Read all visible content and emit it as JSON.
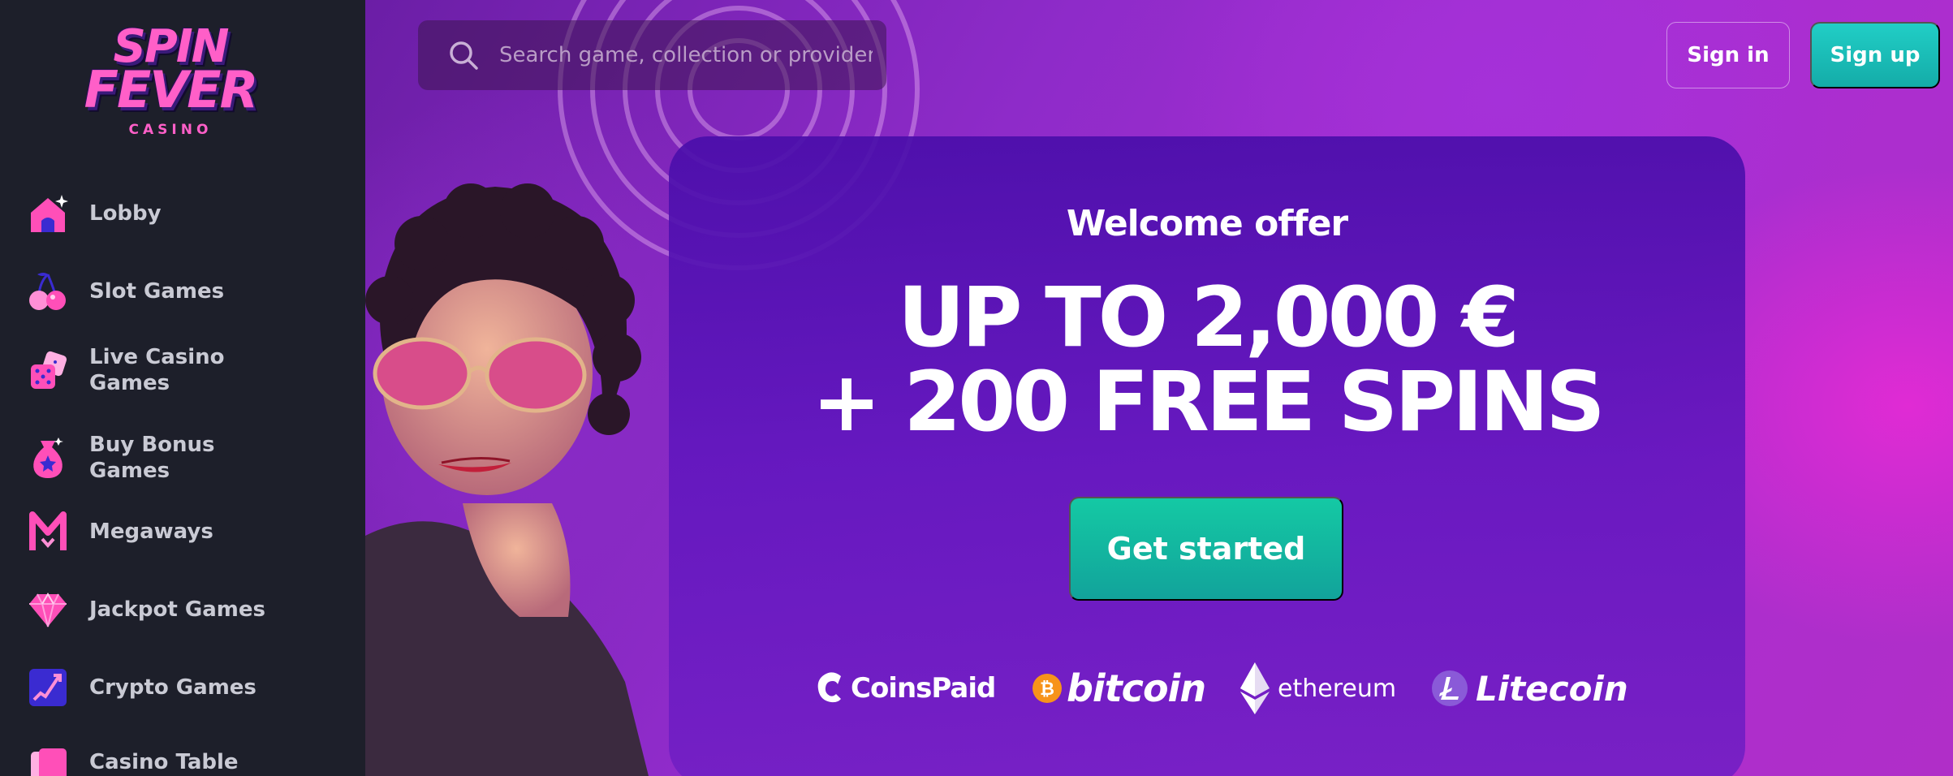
{
  "logo": {
    "line1": "SPIN",
    "line2": "FEVER",
    "line3": "CASINO"
  },
  "sidebar": {
    "items": [
      {
        "label": "Lobby",
        "icon": "house-icon"
      },
      {
        "label": "Slot Games",
        "icon": "cherries-icon"
      },
      {
        "label": "Live Casino\nGames",
        "icon": "dice-icon"
      },
      {
        "label": "Buy Bonus\nGames",
        "icon": "money-bag-icon"
      },
      {
        "label": "Megaways",
        "icon": "megaways-m-icon"
      },
      {
        "label": "Jackpot Games",
        "icon": "diamond-icon"
      },
      {
        "label": "Crypto Games",
        "icon": "crypto-chart-icon"
      },
      {
        "label": "Casino Table",
        "icon": "cards-icon"
      }
    ]
  },
  "header": {
    "search": {
      "placeholder": "Search game, collection or provider"
    },
    "signin_label": "Sign in",
    "signup_label": "Sign up"
  },
  "offer": {
    "welcome": "Welcome offer",
    "headline_line1": "UP TO 2,000 €",
    "headline_line2": "+ 200 FREE SPINS",
    "cta_label": "Get started"
  },
  "payments": [
    {
      "name": "CoinsPaid",
      "icon": "coinspaid-icon"
    },
    {
      "name": "bitcoin",
      "icon": "bitcoin-icon"
    },
    {
      "name": "ethereum",
      "icon": "ethereum-icon"
    },
    {
      "name": "Litecoin",
      "icon": "litecoin-icon"
    }
  ],
  "colors": {
    "sidebar_bg": "#1d1f2a",
    "brand_pink": "#ff5fc8",
    "teal_cta": "#14c9a4",
    "offer_panel": "#4a0eaa"
  }
}
